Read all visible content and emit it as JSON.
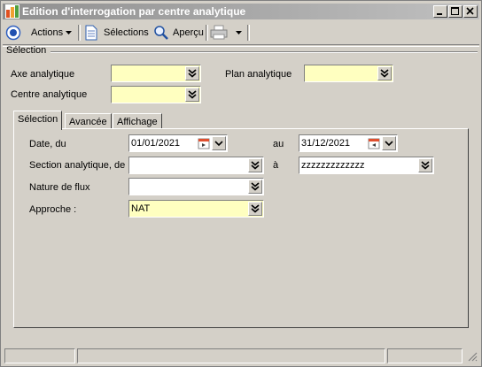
{
  "window": {
    "title": "Edition d'interrogation par centre analytique",
    "icon": "app-window-icon"
  },
  "toolbar": {
    "actions_label": "Actions",
    "selections_label": "Sélections",
    "apercu_label": "Aperçu"
  },
  "selection_group": {
    "label": "Sélection",
    "axe_label": "Axe analytique",
    "axe_value": "",
    "plan_label": "Plan analytique",
    "plan_value": "",
    "centre_label": "Centre analytique",
    "centre_value": ""
  },
  "tabs": [
    {
      "label": "Sélection",
      "active": true
    },
    {
      "label": "Avancée",
      "active": false
    },
    {
      "label": "Affichage",
      "active": false
    }
  ],
  "form": {
    "date_label": "Date, du",
    "date_from": "01/01/2021",
    "au_label": "au",
    "date_to": "31/12/2021",
    "section_label": "Section analytique, de",
    "section_from": "",
    "a_label": "à",
    "section_to": "zzzzzzzzzzzzz",
    "nature_label": "Nature de flux",
    "nature_value": "",
    "approche_label": "Approche :",
    "approche_value": "NAT"
  },
  "colors": {
    "required_field": "#ffffc0",
    "window_bg": "#d4d0c8"
  }
}
